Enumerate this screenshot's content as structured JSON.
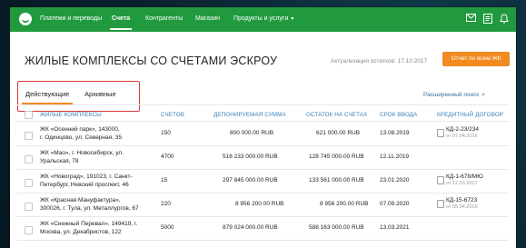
{
  "nav": {
    "items": [
      {
        "label": "Платежи и переводы"
      },
      {
        "label": "Счета"
      },
      {
        "label": "Контрагенты"
      },
      {
        "label": "Магазин"
      },
      {
        "label": "Продукты и услуги"
      }
    ],
    "caret": "▾"
  },
  "page": {
    "title": "ЖИЛЫЕ КОМПЛЕКСЫ СО СЧЕТАМИ ЭСКРОУ",
    "updated": "Актуализация остатков: 17.10.2017",
    "report_button": "Отчет по всем ЖК"
  },
  "tabs": [
    "Действующие",
    "Архивные"
  ],
  "advanced_search": "Расширенный поиск",
  "table": {
    "headers": [
      "ЖИЛЫЕ КОМПЛЕКСЫ",
      "СЧЕТОВ",
      "ДЕПОНИРУЕМАЯ СУММА",
      "ОСТАТОК НА СЧЕТАХ",
      "СРОК ВВОДА",
      "КРЕДИТНЫЙ ДОГОВОР"
    ],
    "rows": [
      {
        "name_line1": "ЖК «Осенний парк», 143000,",
        "name_line2": "г. Одинцово, ул. Северная, 35",
        "accounts": "150",
        "deposit": "800 000.00 RUB",
        "balance": "621 000.00 RUB",
        "deadline": "13.08.2019",
        "contract_no": "КД-2-23/234",
        "contract_date": "от 07.04.2016"
      },
      {
        "name_line1": "ЖК «Мао», г. Новосибирск, ул.",
        "name_line2": "Уральская, 78",
        "accounts": "4700",
        "deposit": "516 233 000.00 RUB",
        "balance": "128 745 000.00 RUB",
        "deadline": "12.11.2019",
        "contract_no": "",
        "contract_date": ""
      },
      {
        "name_line1": "ЖК «Новоград», 191023, г. Санкт-",
        "name_line2": "Петербург, Невский проспект, 46",
        "accounts": "15",
        "deposit": "297 845 000.00 RUB",
        "balance": "133 561 000.00 RUB",
        "deadline": "23.01.2020",
        "contract_no": "КД-1-678/МЮ",
        "contract_date": "от 12.03.2017"
      },
      {
        "name_line1": "ЖК «Красная Мануфактура»,",
        "name_line2": "300026, г. Тула, ул. Металлургов, 67",
        "accounts": "220",
        "deposit": "8 956 200.00 RUB",
        "balance": "8 956 200.00 RUB",
        "deadline": "07.09.2020",
        "contract_no": "КД-15-6723",
        "contract_date": "от 05.04.2016"
      },
      {
        "name_line1": "ЖК «Снежный Перевал», 149419, г.",
        "name_line2": "Москва, ул. Декабристов, 122",
        "accounts": "5000",
        "deposit": "879 024 000.00 RUB",
        "balance": "588 163 000.00 RUB",
        "deadline": "13.03.2021",
        "contract_no": "",
        "contract_date": ""
      }
    ]
  },
  "colors": {
    "nav_green": "#219a3f",
    "accent_orange": "#f28a22",
    "header_blue": "#3a7fb8",
    "highlight_red": "#d83a3a"
  },
  "icons": [
    "mail-icon",
    "document-icon",
    "bell-icon",
    "search-icon"
  ]
}
